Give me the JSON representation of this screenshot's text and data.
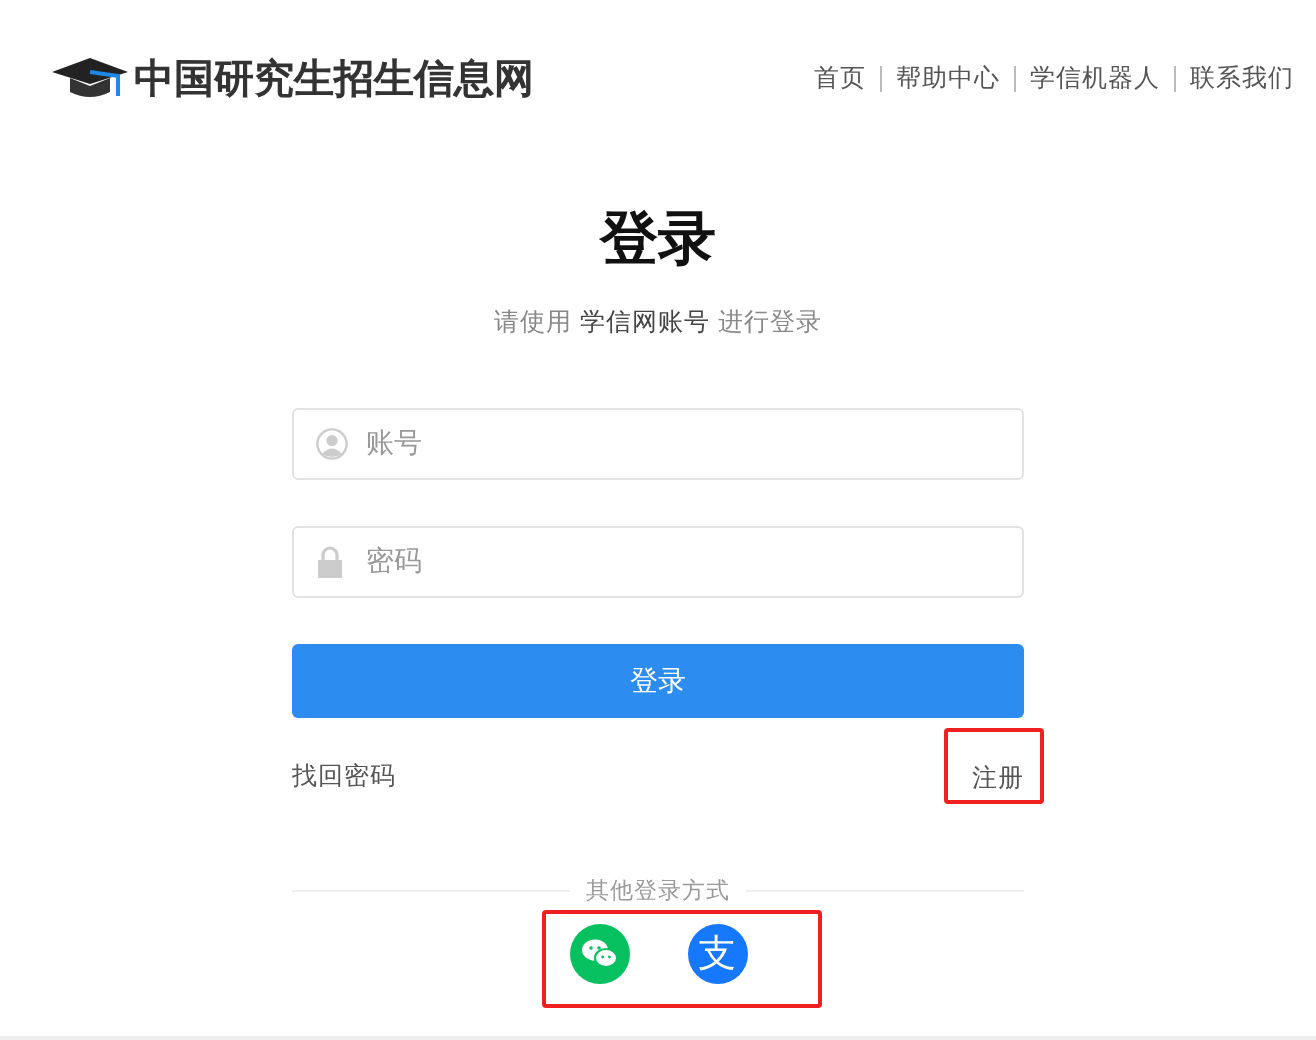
{
  "header": {
    "site_title": "中国研究生招生信息网",
    "nav": [
      "首页",
      "帮助中心",
      "学信机器人",
      "联系我们"
    ]
  },
  "login": {
    "title": "登录",
    "subtitle": "请使用 **学信网账号** 进行登录",
    "fields": [
      {
        "kind": "user",
        "placeholder": "账号"
      },
      {
        "kind": "lock",
        "placeholder": "密码"
      }
    ],
    "submit": "登录",
    "forgot": "找回密码",
    "register": {
      "label": "注册",
      "highlighted": true
    },
    "other_label": "其他登录方式",
    "other_highlighted": true,
    "other_methods": [
      {
        "kind": "wechat"
      },
      {
        "kind": "alipay",
        "glyph": "支"
      }
    ]
  }
}
